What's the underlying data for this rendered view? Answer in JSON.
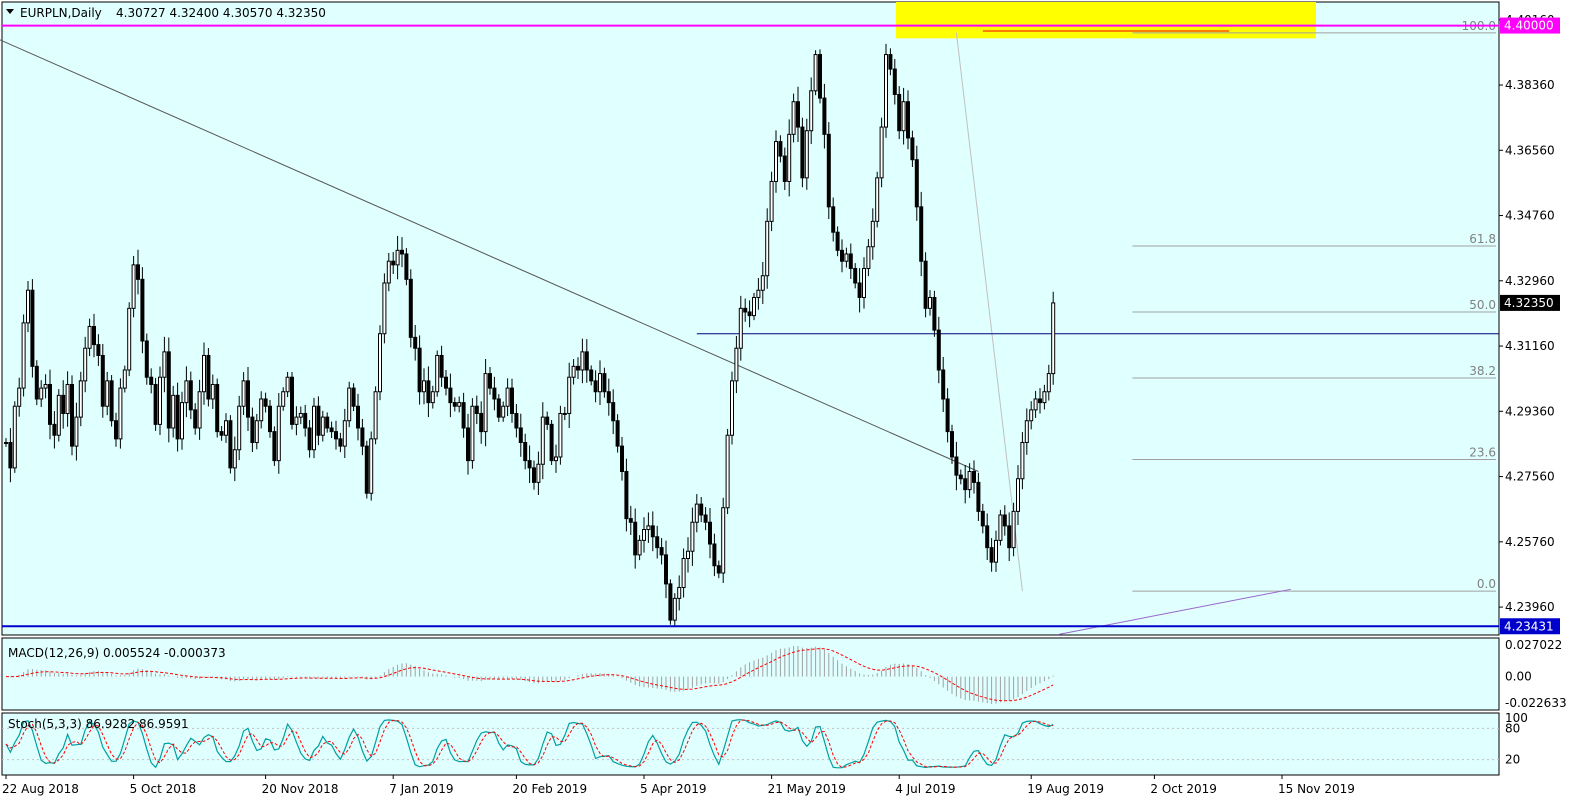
{
  "chart_data": [
    {
      "type": "candlestick",
      "panel": "price",
      "symbol_info": "EURPLN,Daily",
      "ohlc_label": "4.30727 4.32400 4.30570 4.32350",
      "y_ticks": [
        "4.40160",
        "4.38360",
        "4.36560",
        "4.34760",
        "4.32960",
        "4.31160",
        "4.29360",
        "4.27560",
        "4.25760",
        "4.23960"
      ],
      "y_tick_values": [
        4.4016,
        4.3836,
        4.3656,
        4.3476,
        4.3296,
        4.3116,
        4.2936,
        4.2756,
        4.2576,
        4.2396
      ],
      "ylim": [
        4.2319,
        4.4065
      ],
      "x_ticks": [
        "22 Aug 2018",
        "5 Oct 2018",
        "20 Nov 2018",
        "7 Jan 2019",
        "20 Feb 2019",
        "5 Apr 2019",
        "21 May 2019",
        "4 Jul 2019",
        "19 Aug 2019",
        "2 Oct 2019",
        "15 Nov 2019"
      ],
      "price_labels": [
        {
          "text": "4.40000",
          "value": 4.4,
          "color": "#ff00ff"
        },
        {
          "text": "4.32350",
          "value": 4.3235,
          "color": "#000000"
        },
        {
          "text": "4.23431",
          "value": 4.23431,
          "color": "#0000cc"
        }
      ],
      "fibonacci_levels": [
        {
          "label": "100.0",
          "value": 4.398
        },
        {
          "label": "61.8",
          "value": 4.3392
        },
        {
          "label": "50.0",
          "value": 4.321
        },
        {
          "label": "38.2",
          "value": 4.3028
        },
        {
          "label": "23.6",
          "value": 4.2803
        },
        {
          "label": "0.0",
          "value": 4.244
        }
      ],
      "horizontal_lines": [
        {
          "name": "resistance-4.40",
          "value": 4.4,
          "color": "#ff00ff"
        },
        {
          "name": "support-4.23431",
          "value": 4.23431,
          "color": "#0000cc"
        },
        {
          "name": "neckline",
          "value": 4.315,
          "color": "#000080"
        }
      ],
      "series_close": [
        4.285,
        4.278,
        4.295,
        4.3,
        4.318,
        4.327,
        4.306,
        4.297,
        4.3,
        4.301,
        4.29,
        4.287,
        4.298,
        4.293,
        4.301,
        4.284,
        4.292,
        4.302,
        4.311,
        4.317,
        4.312,
        4.309,
        4.295,
        4.302,
        4.291,
        4.286,
        4.3,
        4.305,
        4.322,
        4.334,
        4.33,
        4.313,
        4.303,
        4.301,
        4.29,
        4.303,
        4.31,
        4.289,
        4.298,
        4.286,
        4.296,
        4.302,
        4.294,
        4.289,
        4.299,
        4.309,
        4.297,
        4.301,
        4.288,
        4.287,
        4.291,
        4.278,
        4.283,
        4.295,
        4.302,
        4.292,
        4.285,
        4.291,
        4.297,
        4.295,
        4.288,
        4.28,
        4.295,
        4.299,
        4.303,
        4.29,
        4.292,
        4.293,
        4.289,
        4.283,
        4.295,
        4.287,
        4.292,
        4.289,
        4.288,
        4.286,
        4.284,
        4.291,
        4.3,
        4.295,
        4.289,
        4.284,
        4.271,
        4.286,
        4.299,
        4.315,
        4.329,
        4.335,
        4.334,
        4.338,
        4.337,
        4.33,
        4.314,
        4.311,
        4.299,
        4.302,
        4.296,
        4.299,
        4.309,
        4.303,
        4.3,
        4.296,
        4.295,
        4.296,
        4.289,
        4.28,
        4.295,
        4.293,
        4.288,
        4.304,
        4.3,
        4.297,
        4.292,
        4.295,
        4.3,
        4.293,
        4.289,
        4.285,
        4.28,
        4.278,
        4.274,
        4.279,
        4.292,
        4.29,
        4.28,
        4.281,
        4.293,
        4.293,
        4.303,
        4.306,
        4.305,
        4.31,
        4.305,
        4.302,
        4.299,
        4.304,
        4.299,
        4.296,
        4.291,
        4.284,
        4.277,
        4.264,
        4.263,
        4.254,
        4.258,
        4.261,
        4.262,
        4.259,
        4.256,
        4.254,
        4.246,
        4.236,
        4.242,
        4.245,
        4.253,
        4.255,
        4.263,
        4.268,
        4.265,
        4.263,
        4.257,
        4.251,
        4.249,
        4.267,
        4.287,
        4.302,
        4.311,
        4.322,
        4.321,
        4.32,
        4.325,
        4.327,
        4.331,
        4.346,
        4.357,
        4.368,
        4.364,
        4.357,
        4.37,
        4.379,
        4.372,
        4.358,
        4.371,
        4.382,
        4.392,
        4.38,
        4.37,
        4.35,
        4.343,
        4.338,
        4.335,
        4.337,
        4.333,
        4.329,
        4.325,
        4.333,
        4.339,
        4.346,
        4.358,
        4.372,
        4.392,
        4.388,
        4.381,
        4.371,
        4.379,
        4.369,
        4.363,
        4.35,
        4.335,
        4.322,
        4.325,
        4.316,
        4.305,
        4.297,
        4.288,
        4.281,
        4.276,
        4.275,
        4.272,
        4.277,
        4.274,
        4.266,
        4.262,
        4.256,
        4.252,
        4.258,
        4.265,
        4.262,
        4.256,
        4.266,
        4.275,
        4.285,
        4.291,
        4.294,
        4.297,
        4.296,
        4.299,
        4.304,
        4.3235
      ],
      "series_low": 4.236,
      "trendlines": [
        {
          "name": "descending-trendline",
          "from": {
            "bar": -5,
            "value": 4.398
          },
          "to": {
            "bar": 221,
            "value": 4.277
          },
          "color": "#555555"
        },
        {
          "name": "rising-channel-line",
          "from": {
            "bar": 239,
            "value": 4.232
          },
          "to": {
            "bar": 292,
            "value": 4.2445
          },
          "color": "#9966cc"
        },
        {
          "name": "fib-diagonal",
          "from": {
            "bar": 216,
            "value": 4.398
          },
          "to": {
            "bar": 231,
            "value": 4.244
          },
          "color": "#c0c0c0"
        }
      ],
      "highlight_zone": {
        "name": "target-zone",
        "value_top": 4.4065,
        "value_bottom": 4.402,
        "color": "#ffff00"
      }
    },
    {
      "type": "histogram+line",
      "panel": "macd",
      "title": "MACD(12,26,9) 0.005524 -0.000373",
      "y_ticks": [
        "0.027022",
        "0.00",
        "-0.022633"
      ],
      "y_tick_values": [
        0.027022,
        0.0,
        -0.022633
      ]
    },
    {
      "type": "line",
      "panel": "stochastic",
      "title": "Stoch(5,3,3) 86.9282 86.9591",
      "y_ticks": [
        "100",
        "80",
        "20"
      ],
      "y_tick_values": [
        100,
        80,
        20
      ],
      "main_color": "#00a0a0",
      "signal_color": "#ff0000"
    }
  ],
  "colors": {
    "plot_bg": "#e0ffff",
    "candle": "#000000",
    "magenta": "#ff00ff",
    "blue": "#0000cc",
    "navy": "#000080",
    "yellow": "#ffff00",
    "fib": "#a0a0a0"
  }
}
